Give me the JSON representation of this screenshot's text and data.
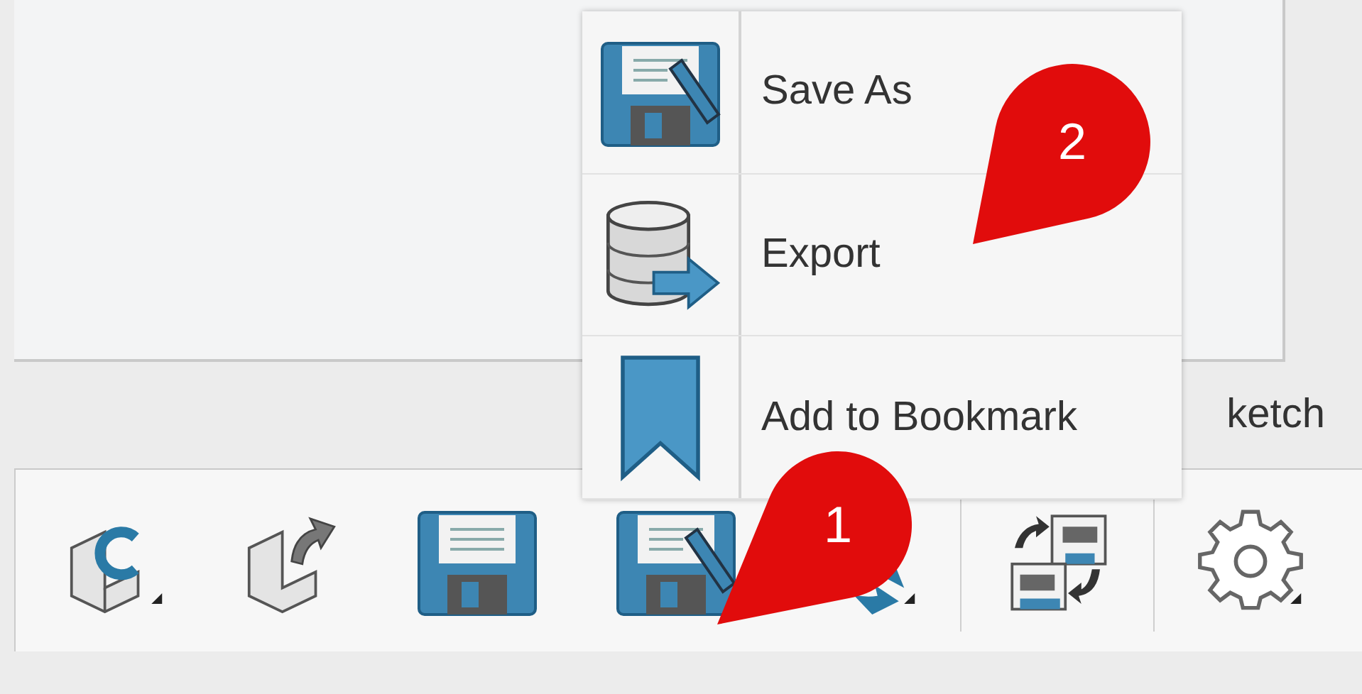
{
  "tab_strip": {
    "label": "ketch"
  },
  "menu": {
    "items": [
      {
        "label": "Save As",
        "kind": "save_as"
      },
      {
        "label": "Export",
        "kind": "export"
      },
      {
        "label": "Add to Bookmark",
        "kind": "bookmark"
      }
    ]
  },
  "callouts": [
    {
      "label": "1"
    },
    {
      "label": "2"
    }
  ]
}
